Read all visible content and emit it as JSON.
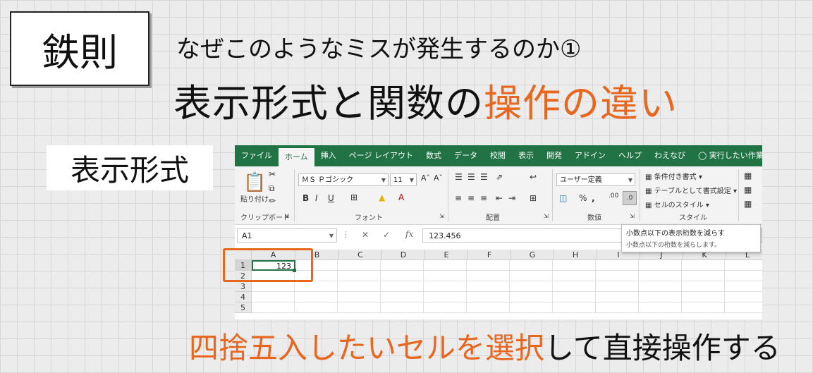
{
  "slide": {
    "tag": "鉄則",
    "subtitle": "なぜこのようなミスが発生するのか①",
    "headline_main": "表示形式と関数の",
    "headline_accent": "操作の違い",
    "label": "表示形式",
    "footer_accent": "四捨五入したいセルを選択",
    "footer_rest": "して直接操作する",
    "accent_color": "#e8661e"
  },
  "excel": {
    "tabs": [
      "ファイル",
      "ホーム",
      "挿入",
      "ページ レイアウト",
      "数式",
      "データ",
      "校閲",
      "表示",
      "開発",
      "アドイン",
      "ヘルプ",
      "わえなび",
      "実行したい作業を入力し"
    ],
    "active_tab": "ホーム",
    "ribbon": {
      "clipboard": {
        "paste_label": "貼り付け",
        "group_label": "クリップボード"
      },
      "font": {
        "font_name": "ＭＳ Ｐゴシック",
        "font_size": "11",
        "group_label": "フォント"
      },
      "alignment": {
        "group_label": "配置"
      },
      "number": {
        "format": "ユーザー定義",
        "group_label": "数値"
      },
      "styles": {
        "conditional": "条件付き書式",
        "table": "テーブルとして書式設定",
        "cell_styles": "セルのスタイル",
        "group_label": "スタイル"
      }
    },
    "name_box": "A1",
    "formula_value": "123.456",
    "fx_label": "fx",
    "tooltip": {
      "title": "小数点以下の表示桁数を減らす",
      "desc": "小数点以下の桁数を減らします。"
    },
    "columns": [
      "A",
      "B",
      "C",
      "D",
      "E",
      "F",
      "G",
      "H",
      "I",
      "J",
      "K",
      "L"
    ],
    "rows": [
      "1",
      "2",
      "3",
      "4",
      "5"
    ],
    "cell_a1": "123"
  }
}
